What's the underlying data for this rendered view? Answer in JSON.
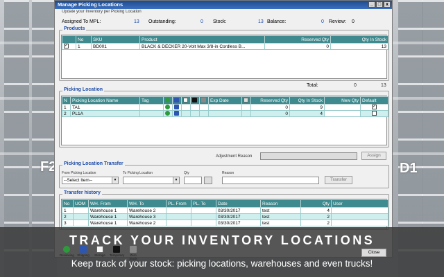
{
  "window": {
    "title": "Manage Picking Locations",
    "subtitle": "Update your Inventory per Picking Location",
    "controls": {
      "minimize": "_",
      "maximize": "□",
      "close": "x"
    }
  },
  "summary": {
    "assigned_label": "Assigned To MPL:",
    "assigned_value": "13",
    "outstanding_label": "Outstanding:",
    "outstanding_value": "0",
    "stock_label": "Stock:",
    "stock_value": "13",
    "balance_label": "Balance:",
    "balance_value": "0",
    "review_label": "Review:",
    "review_value": "0"
  },
  "products": {
    "title": "Products",
    "columns": [
      "No",
      "SKU",
      "Product",
      "Reserved Qty",
      "Qty In Stock"
    ],
    "rows": [
      {
        "checked": true,
        "no": "1",
        "sku": "BD001",
        "product": "BLACK & DECKER 20-Volt Max 3/8-in Cordless B...",
        "reserved": "0",
        "in_stock": "13"
      }
    ],
    "total_label": "Total:",
    "total_reserved": "0",
    "total_stock": "13"
  },
  "picking_location": {
    "title": "Picking Location",
    "columns": [
      "N",
      "Picking Location Name",
      "Tag",
      "",
      "",
      "",
      "",
      "",
      "Exp Date",
      "",
      "Reserved Qty",
      "Qty In Stock",
      "New Qty",
      "Default"
    ],
    "rows": [
      {
        "no": "1",
        "name": "TA1",
        "reserved": "0",
        "in_stock": "9",
        "new_qty": "",
        "default": true
      },
      {
        "no": "2",
        "name": "PL1A",
        "reserved": "0",
        "in_stock": "4",
        "new_qty": "",
        "default": false
      }
    ],
    "adjustment_label": "Adjustment Reason",
    "assign_label": "Assign"
  },
  "transfer": {
    "title": "Picking Location Transfer",
    "from_label": "From Picking Location",
    "from_value": "--Select Item--",
    "to_label": "To Picking Location",
    "qty_label": "Qty",
    "reason_label": "Reason",
    "transfer_label": "Transfer"
  },
  "history": {
    "title": "Transfer history",
    "columns": [
      "No",
      "UOM",
      "WH. From",
      "WH. To",
      "PL. From",
      "PL. To",
      "Date",
      "Reason",
      "Qty",
      "User"
    ],
    "rows": [
      {
        "no": "1",
        "uom": "",
        "wh_from": "Warehouse 1",
        "wh_to": "Warehouse 2",
        "pl_from": "",
        "pl_to": "",
        "date": "03/30/2017",
        "reason": "test",
        "qty": "4",
        "user": ""
      },
      {
        "no": "2",
        "uom": "",
        "wh_from": "Warehouse 1",
        "wh_to": "Warehouse 3",
        "pl_from": "",
        "pl_to": "",
        "date": "03/30/2017",
        "reason": "test",
        "qty": "2",
        "user": ""
      },
      {
        "no": "3",
        "uom": "",
        "wh_from": "Warehouse 1",
        "wh_to": "Warehouse 2",
        "pl_from": "",
        "pl_to": "",
        "date": "03/30/2017",
        "reason": "test",
        "qty": "2",
        "user": ""
      }
    ]
  },
  "toolbar": [
    "Reviewing",
    "Shipping",
    "Storage",
    "Temporary",
    "Zero Stock"
  ],
  "close_label": "Close",
  "background_labels": {
    "left": "F2",
    "right": "D1"
  },
  "banner": {
    "title": "TRACK YOUR INVENTORY LOCATIONS",
    "subtitle": "Keep track of your stock: picking locations, warehouses and even trucks!"
  }
}
